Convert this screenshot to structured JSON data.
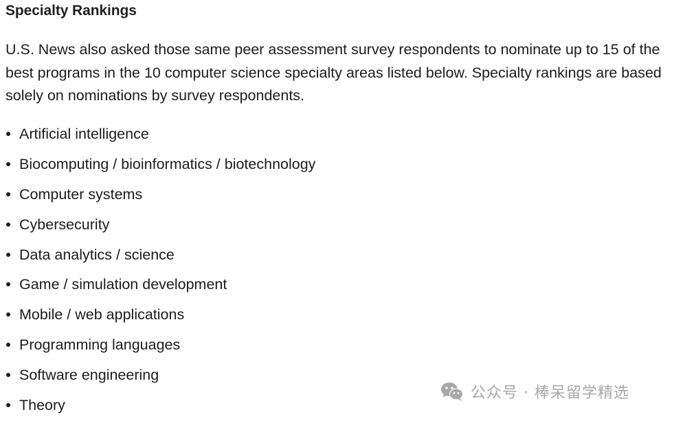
{
  "section": {
    "heading": "Specialty Rankings",
    "intro": "U.S. News also asked those same peer assessment survey respondents to nominate up to 15 of the best programs in the 10 computer science specialty areas listed below. Specialty rankings are based solely on nominations by survey respondents.",
    "specialties": [
      "Artificial intelligence",
      "Biocomputing / bioinformatics / biotechnology",
      "Computer systems",
      "Cybersecurity",
      "Data analytics / science",
      "Game / simulation development",
      "Mobile / web applications",
      "Programming languages",
      "Software engineering",
      "Theory"
    ]
  },
  "watermark": {
    "icon": "wechat-icon",
    "text": "公众号 · 棒呆留学精选",
    "color": "#a8a8a8"
  }
}
